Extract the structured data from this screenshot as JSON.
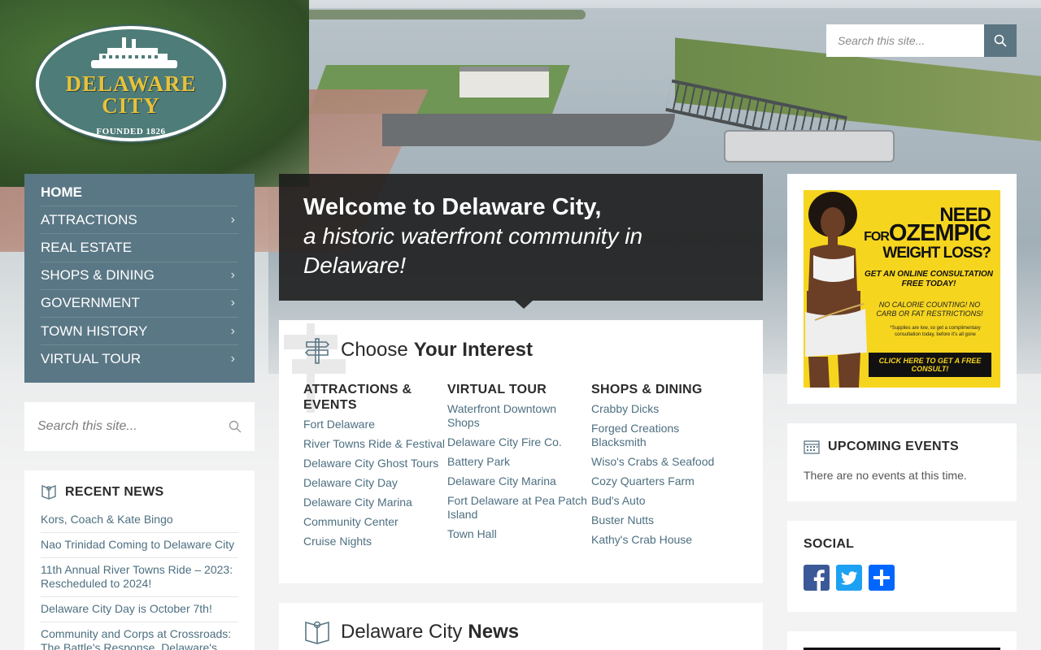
{
  "logo": {
    "title": "DELAWARE\nCITY",
    "tagline": "FOUNDED 1826"
  },
  "header_search": {
    "placeholder": "Search this site..."
  },
  "nav": {
    "items": [
      {
        "label": "HOME",
        "active": true,
        "has_submenu": false
      },
      {
        "label": "ATTRACTIONS",
        "active": false,
        "has_submenu": true
      },
      {
        "label": "REAL ESTATE",
        "active": false,
        "has_submenu": false
      },
      {
        "label": "SHOPS & DINING",
        "active": false,
        "has_submenu": true
      },
      {
        "label": "GOVERNMENT",
        "active": false,
        "has_submenu": true
      },
      {
        "label": "TOWN HISTORY",
        "active": false,
        "has_submenu": true
      },
      {
        "label": "VIRTUAL TOUR",
        "active": false,
        "has_submenu": true
      }
    ]
  },
  "side_search": {
    "placeholder": "Search this site..."
  },
  "recent_news": {
    "title": "RECENT NEWS",
    "items": [
      "Kors, Coach & Kate Bingo",
      "Nao Trinidad Coming to Delaware City",
      "11th Annual River Towns Ride – 2023: Rescheduled to 2024!",
      "Delaware City Day is October 7th!",
      "Community and Corps at Crossroads: The Battle's Response. Delaware's..."
    ]
  },
  "welcome": {
    "line1": "Welcome to Delaware City,",
    "line2": "a historic waterfront community in Delaware!"
  },
  "interest": {
    "title_light": "Choose",
    "title_bold": "Your Interest",
    "columns": [
      {
        "heading": "ATTRACTIONS & EVENTS",
        "links": [
          "Fort Delaware",
          "River Towns Ride & Festival",
          "Delaware City Ghost Tours",
          "Delaware City Day",
          "Delaware City Marina",
          "Community Center",
          "Cruise Nights"
        ]
      },
      {
        "heading": "VIRTUAL TOUR",
        "links": [
          "Waterfront Downtown Shops",
          "Delaware City Fire Co.",
          "Battery Park",
          "Delaware City Marina",
          "Fort Delaware at Pea Patch Island",
          "Town Hall"
        ]
      },
      {
        "heading": "SHOPS & DINING",
        "links": [
          "Crabby Dicks",
          "Forged Creations Blacksmith",
          "Wiso's Crabs & Seafood",
          "Cozy Quarters Farm",
          "Bud's Auto",
          "Buster Nutts",
          "Kathy's Crab House"
        ]
      }
    ]
  },
  "city_news": {
    "title_light": "Delaware City",
    "title_bold": "News"
  },
  "ad": {
    "line1": "NEED",
    "line2_small": "FOR",
    "line2_big": "OZEMPIC",
    "line3": "WEIGHT LOSS?",
    "line4": "GET AN ONLINE CONSULTATION FREE TODAY!",
    "line5": "NO CALORIE COUNTING! NO CARB OR FAT RESTRICTIONS!",
    "line6": "*Supplies are low, so get a complimentary consultation today, before it's all gone",
    "cta": "CLICK HERE TO GET A FREE CONSULT!"
  },
  "events": {
    "title": "UPCOMING EVENTS",
    "text": "There are no events at this time."
  },
  "social": {
    "title": "SOCIAL",
    "buttons": [
      "facebook-icon",
      "twitter-icon",
      "share-icon"
    ]
  },
  "colors": {
    "nav_bg": "#5a7785",
    "link": "#4d6f80",
    "search_btn": "#5c7582",
    "facebook": "#3b5998",
    "twitter": "#1da1f2",
    "share": "#0166ff"
  }
}
